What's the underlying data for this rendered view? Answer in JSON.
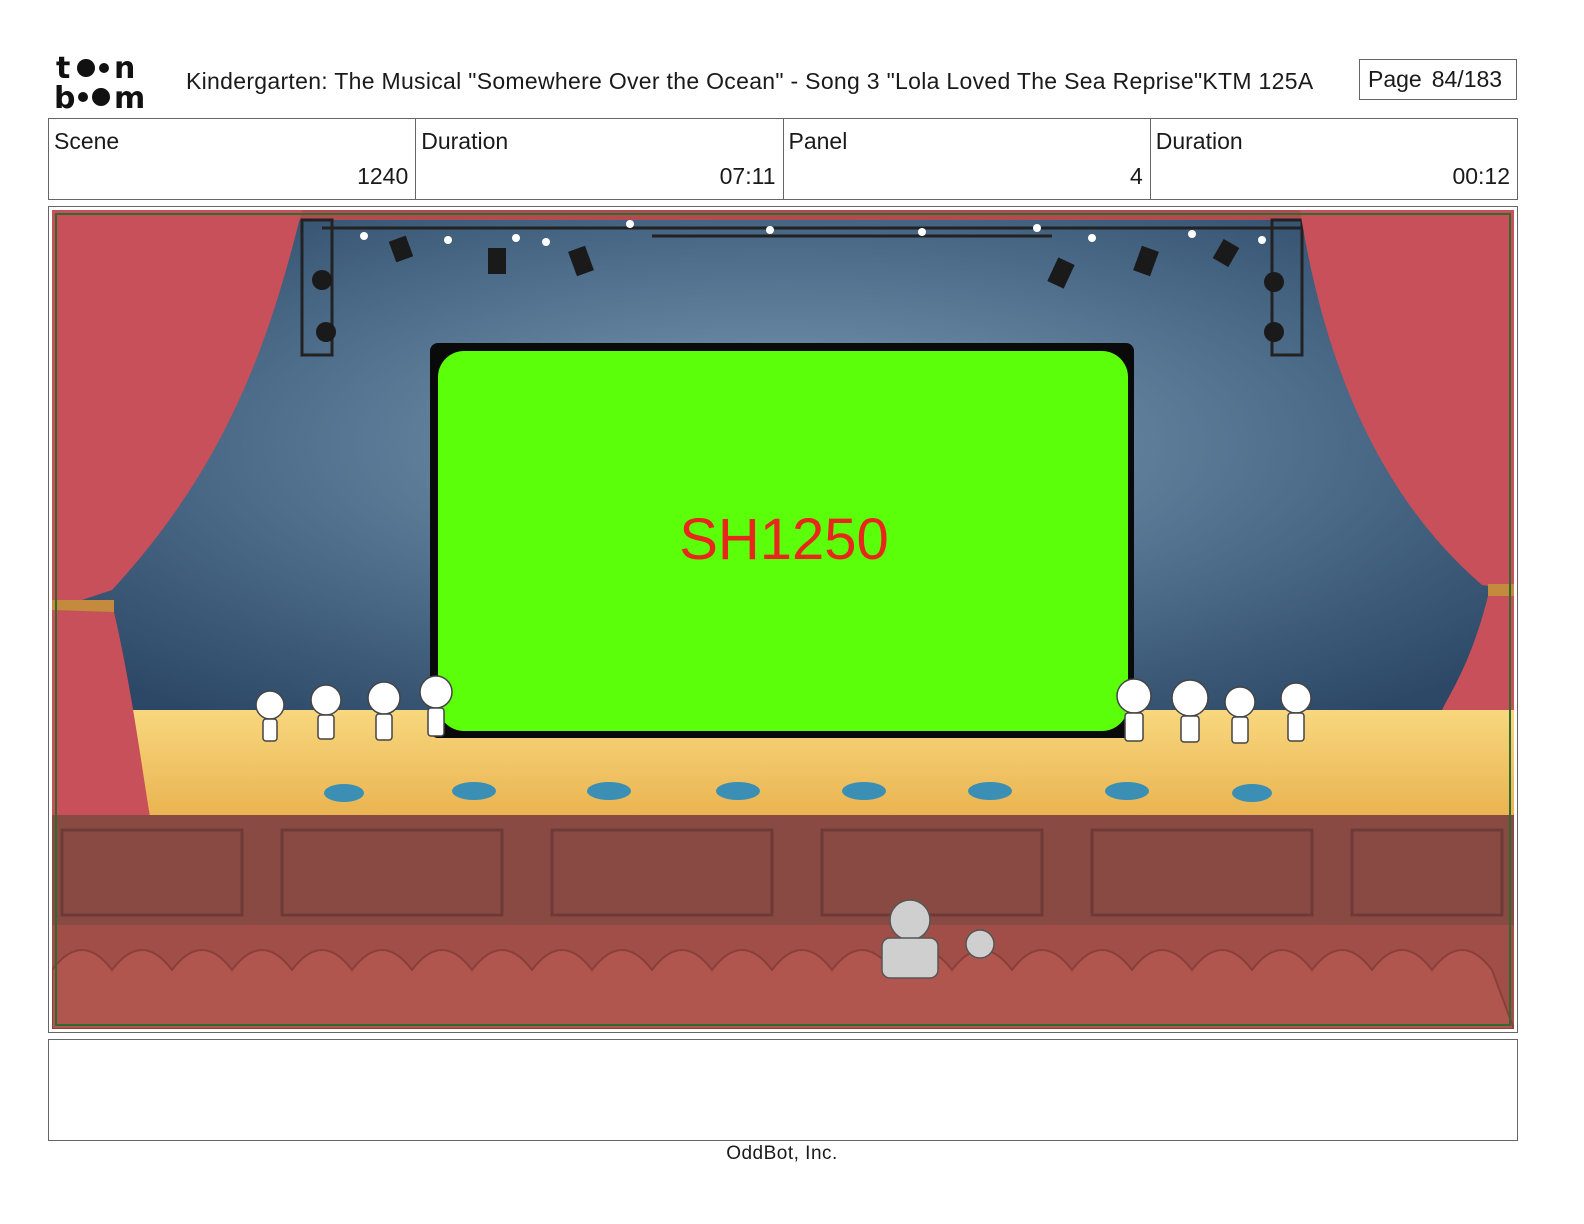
{
  "header": {
    "logo_text": "toon boom",
    "title": "Kindergarten: The Musical  \"Somewhere Over the Ocean\" - Song 3 \"Lola Loved The Sea Reprise\"KTM 125A",
    "page_label": "Page",
    "page_number": "84/183"
  },
  "info": {
    "scene_label": "Scene",
    "scene_value": "1240",
    "scene_duration_label": "Duration",
    "scene_duration_value": "07:11",
    "panel_label": "Panel",
    "panel_value": "4",
    "panel_duration_label": "Duration",
    "panel_duration_value": "00:12"
  },
  "panel": {
    "screen_text": "SH1250",
    "screen_color": "#5cff0a",
    "screen_text_color": "#e8261c",
    "curtain_color": "#c8505a",
    "stage_color": "#f5c866",
    "seat_color": "#a24e48"
  },
  "notes": {
    "text": ""
  },
  "footer": {
    "company": "OddBot, Inc."
  }
}
